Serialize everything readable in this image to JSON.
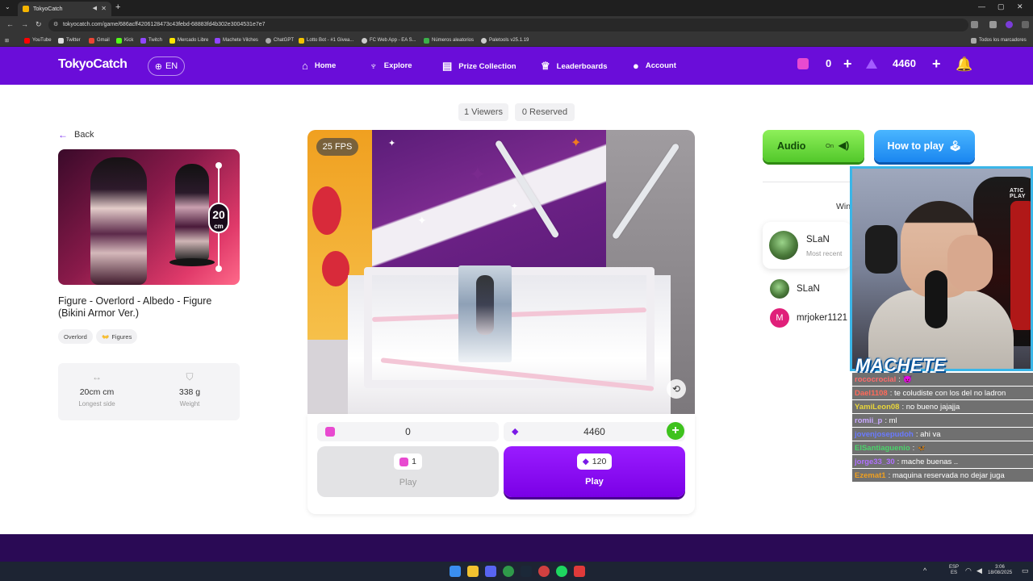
{
  "browser": {
    "tab_title": "TokyoCatch",
    "url": "tokyocatch.com/game/686acff4206128473c43febd-68883fd4b302e3004531e7e7",
    "bookmarks": [
      "YouTube",
      "Twitter",
      "Gmail",
      "Kick",
      "Twitch",
      "Mercado Libre",
      "Machete Vilches",
      "ChatGPT",
      "Lotto Bot - #1 Givea...",
      "FC Web App - EA S...",
      "Números aleatorios",
      "Paletools v25.1.19"
    ],
    "all_bookmarks": "Todos los marcadores"
  },
  "header": {
    "logo": "TokyoCatch",
    "lang": "EN",
    "nav": [
      "Home",
      "Explore",
      "Prize Collection",
      "Leaderboards",
      "Account"
    ],
    "tickets": "0",
    "points": "4460"
  },
  "room": {
    "viewers": "1 Viewers",
    "reserved": "0 Reserved",
    "fps": "25 FPS"
  },
  "product": {
    "back": "Back",
    "size_num": "20",
    "size_unit": "cm",
    "title": "Figure - Overlord - Albedo - Figure (Bikini Armor Ver.)",
    "tags": [
      "Overlord",
      "Figures"
    ],
    "tag_icon": "👐",
    "specs": [
      {
        "value": "20cm cm",
        "label": "Longest side"
      },
      {
        "value": "338 g",
        "label": "Weight"
      }
    ]
  },
  "controls": {
    "ticket_balance": "0",
    "point_balance": "4460",
    "ticket_cost": "1",
    "point_cost": "120",
    "play_label": "Play"
  },
  "side": {
    "audio": "Audio",
    "audio_state": "On",
    "howto": "How to play",
    "winners_label": "Win",
    "recent_winner": "SLaN",
    "recent_sub": "Most recent",
    "winners": [
      "SLaN",
      "mrjoker1121"
    ],
    "m_initial": "M"
  },
  "stream": {
    "chair_logo": "ATIC PLAY",
    "name": "MACHETE",
    "chat": [
      {
        "user": "rococrocial",
        "msg": ": 😈",
        "color": "#ff6b6b"
      },
      {
        "user": "Dael1108",
        "msg": ": te coludiste con los del no ladron",
        "color": "#ff6a5a"
      },
      {
        "user": "YamiLeon08",
        "msg": ": no bueno jajajja",
        "color": "#e9d63a"
      },
      {
        "user": "romii_p",
        "msg": ": ml",
        "color": "#c8a8ff"
      },
      {
        "user": "jovenjosepudoh",
        "msg": ": ahi va",
        "color": "#6a7aff"
      },
      {
        "user": "ElSantiaguenio",
        "msg": ": 🦋",
        "color": "#4ad46a"
      },
      {
        "user": "jorge33_30",
        "msg": ": mache buenas ..",
        "color": "#b070ff"
      },
      {
        "user": "Ezemat1",
        "msg": ": maquina reservada no dejar juga",
        "color": "#f0a020"
      }
    ]
  },
  "taskbar": {
    "lang1": "ESP",
    "lang2": "ES",
    "time": "3:06",
    "date": "18/08/2025"
  },
  "colors": {
    "brand": "#6a0dd9",
    "play": "#8a0cf5",
    "audio": "#52c82a",
    "howto": "#1a86f0"
  }
}
